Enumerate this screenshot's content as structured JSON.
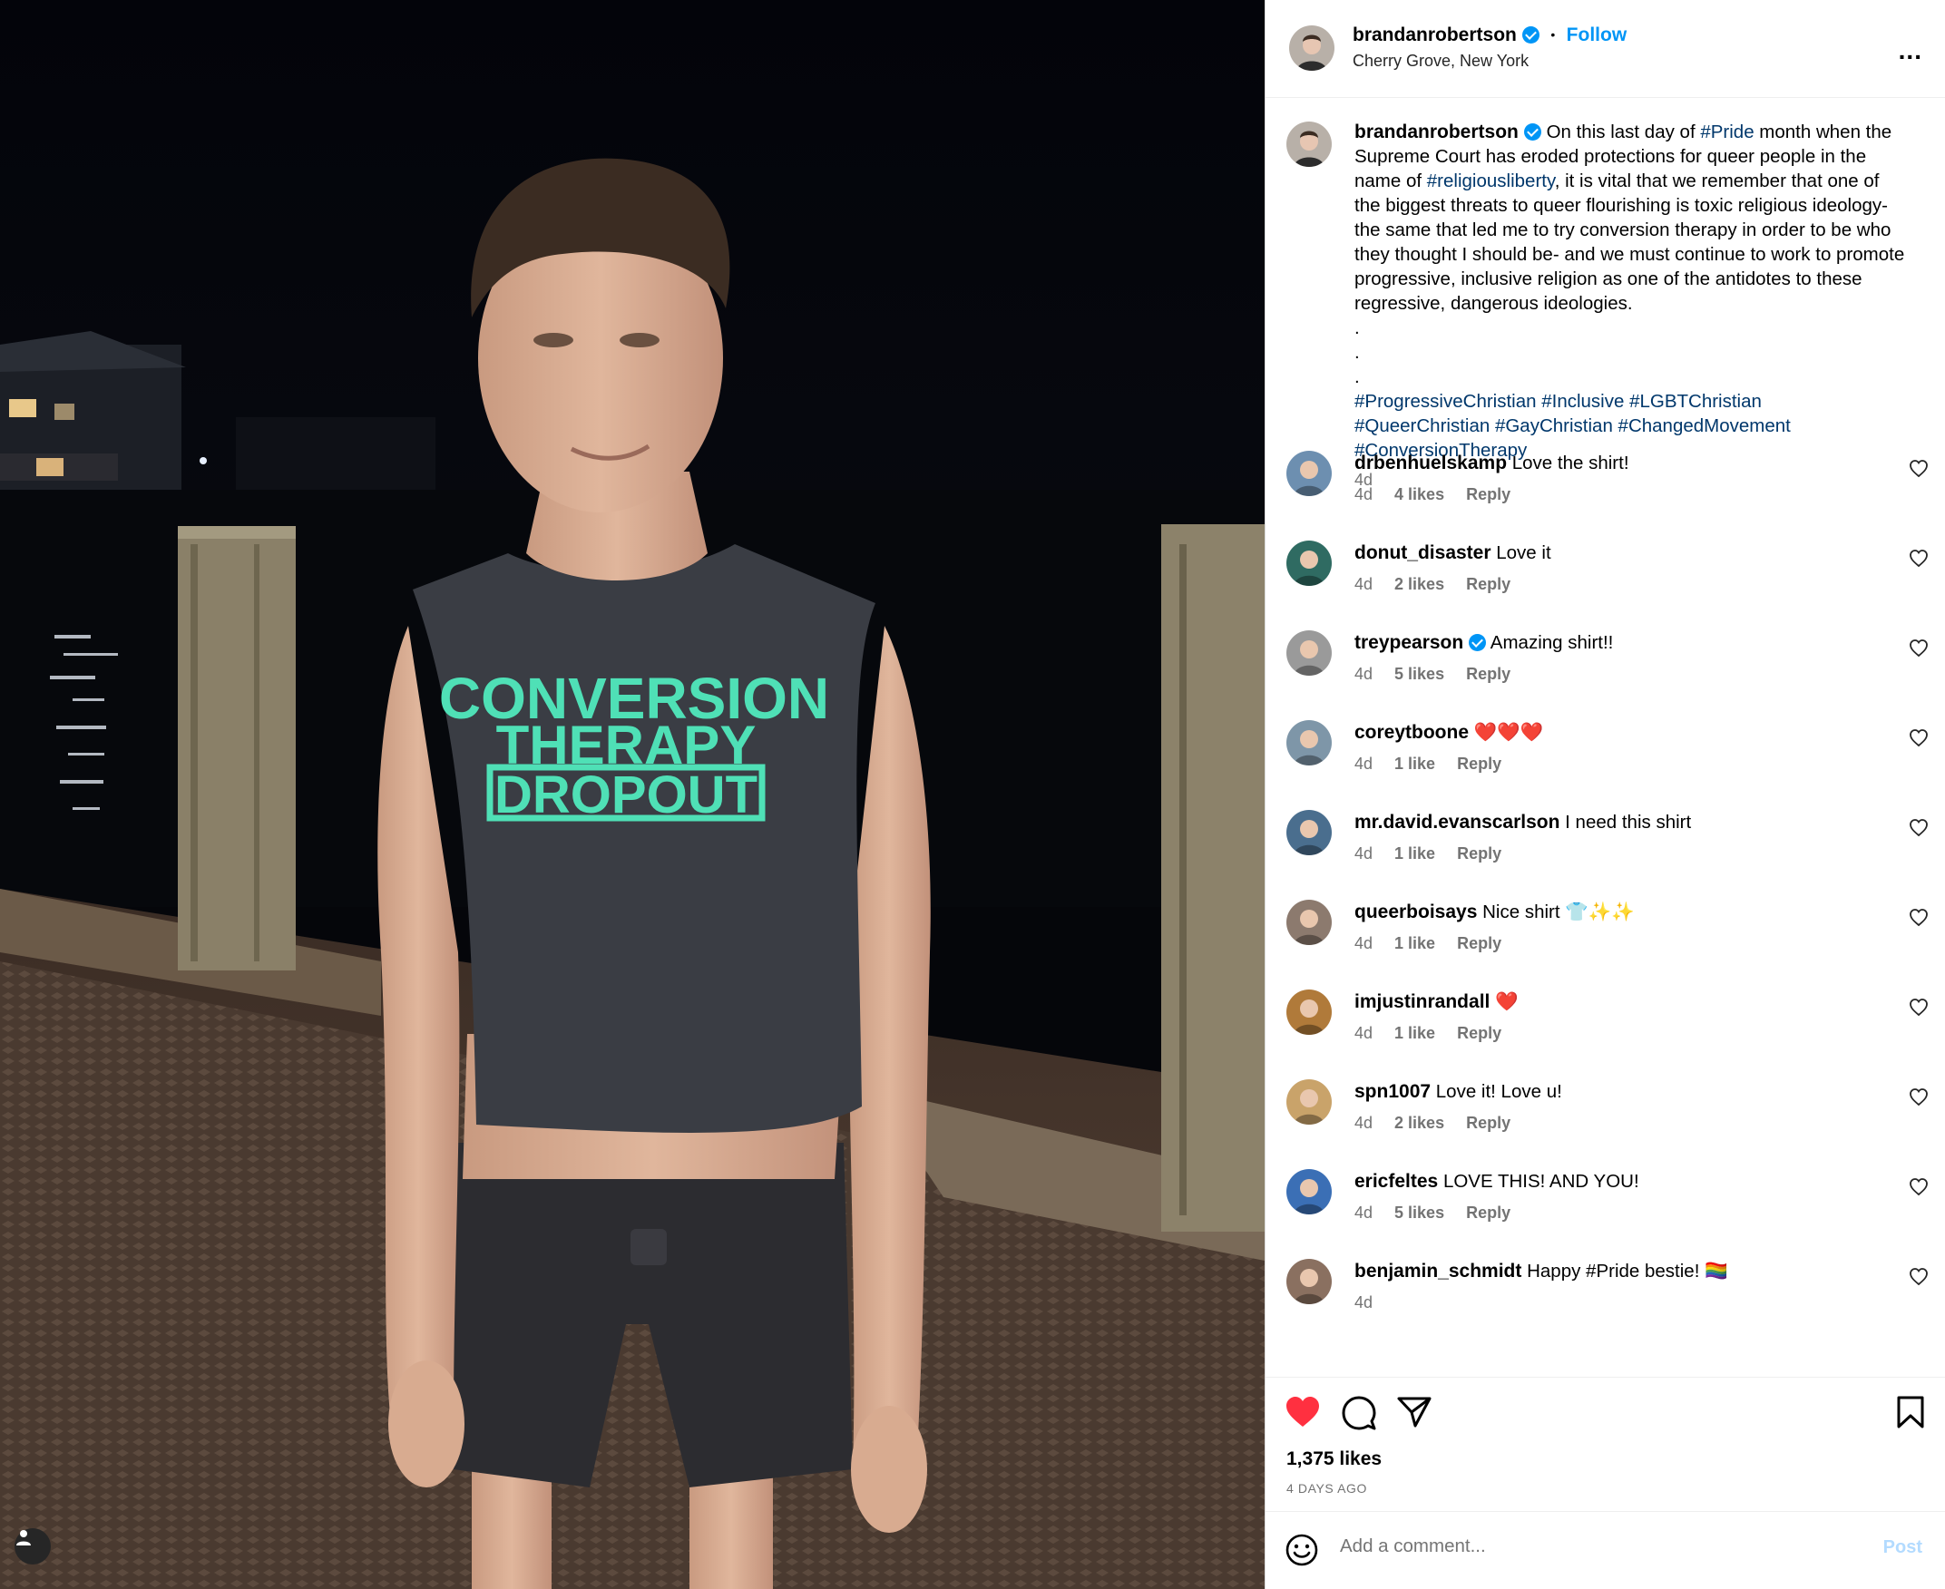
{
  "post": {
    "username": "brandanrobertson",
    "follow_label": "Follow",
    "separator": "•",
    "location": "Cherry Grove, New York",
    "more_label": "..."
  },
  "caption": {
    "username": "brandanrobertson",
    "text_1": "On this last day of ",
    "tag_1": "#Pride",
    "text_2": " month when the Supreme Court has eroded protections for queer people in the name of ",
    "tag_2": "#religiousliberty",
    "text_3": ", it is vital that we remember that one of the biggest threats to queer flourishing is toxic religious ideology- the same that led me to try conversion therapy in order to be who they thought I should be- and we must continue to work to promote progressive, inclusive religion as one of the antidotes to these regressive, dangerous ideologies.",
    "dot": ".",
    "hashtags_1": "#ProgressiveChristian #Inclusive #LGBTChristian",
    "hashtags_2": "#QueerChristian #GayChristian #ChangedMovement",
    "hashtags_3": "#ConversionTherapy",
    "time": "4d"
  },
  "comments": [
    {
      "user": "drbenhuelskamp",
      "text": "Love the shirt!",
      "time": "4d",
      "likes": "4 likes",
      "reply": "Reply",
      "verified": false,
      "avatar_color": "#6d8fb0"
    },
    {
      "user": "donut_disaster",
      "text": "Love it",
      "time": "4d",
      "likes": "2 likes",
      "reply": "Reply",
      "verified": false,
      "avatar_color": "#2f6b62"
    },
    {
      "user": "treypearson",
      "text": "Amazing shirt!!",
      "time": "4d",
      "likes": "5 likes",
      "reply": "Reply",
      "verified": true,
      "avatar_color": "#9a9a9a"
    },
    {
      "user": "coreytboone",
      "text": "❤️❤️❤️",
      "time": "4d",
      "likes": "1 like",
      "reply": "Reply",
      "verified": false,
      "avatar_color": "#7e96a8"
    },
    {
      "user": "mr.david.evanscarlson",
      "text": "I need this shirt",
      "time": "4d",
      "likes": "1 like",
      "reply": "Reply",
      "verified": false,
      "avatar_color": "#4a6e8e"
    },
    {
      "user": "queerboisays",
      "text": "Nice shirt 👕✨✨",
      "time": "4d",
      "likes": "1 like",
      "reply": "Reply",
      "verified": false,
      "avatar_color": "#8c7a6e"
    },
    {
      "user": "imjustinrandall",
      "text": "❤️",
      "time": "4d",
      "likes": "1 like",
      "reply": "Reply",
      "verified": false,
      "avatar_color": "#b07a3a"
    },
    {
      "user": "spn1007",
      "text": "Love it! Love u!",
      "time": "4d",
      "likes": "2 likes",
      "reply": "Reply",
      "verified": false,
      "avatar_color": "#c9a36a"
    },
    {
      "user": "ericfeltes",
      "text": "LOVE THIS! AND YOU!",
      "time": "4d",
      "likes": "5 likes",
      "reply": "Reply",
      "verified": false,
      "avatar_color": "#3b6fb5"
    },
    {
      "user": "benjamin_schmidt",
      "text": "Happy #Pride bestie! 🏳️‍🌈",
      "time": "4d",
      "likes": "",
      "reply": "",
      "verified": false,
      "avatar_color": "#8a7060"
    }
  ],
  "actions": {
    "likes": "1,375 likes",
    "date": "4 DAYS AGO",
    "comment_placeholder": "Add a comment...",
    "post_label": "Post"
  },
  "shirt": {
    "line1": "CONVERSION",
    "line2": "THERAPY",
    "line3": "DROPOUT"
  },
  "colors": {
    "like_red": "#ff3040",
    "link_blue": "#0095f6",
    "hashtag_blue": "#00376b",
    "shirt_text": "#4fe0b6"
  },
  "icons": {
    "verified": "verified-badge-icon",
    "more": "more-options-icon",
    "like": "heart-icon",
    "comment": "comment-icon",
    "share": "share-icon",
    "save": "bookmark-icon",
    "emoji": "emoji-icon",
    "tag": "user-tag-icon"
  }
}
